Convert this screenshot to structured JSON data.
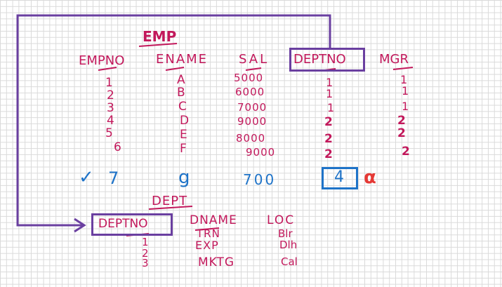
{
  "emp_table": {
    "title": "EMP",
    "headers": [
      "EMPNO",
      "ENAME",
      "SAL",
      "DEPTNO",
      "MGR"
    ],
    "rows": [
      [
        "1",
        "A",
        "5000",
        "1",
        "1"
      ],
      [
        "2",
        "B",
        "6000",
        "1",
        "1"
      ],
      [
        "3",
        "C",
        "7000",
        "1",
        "1"
      ],
      [
        "4",
        "D",
        "9000",
        "2",
        "2"
      ],
      [
        "5",
        "E",
        "8000",
        "2",
        "2"
      ],
      [
        "6",
        "F",
        "9000",
        "2",
        "2"
      ]
    ],
    "new_row": {
      "check": "✓",
      "empno": "7",
      "ename": "g",
      "sal": "700",
      "deptno": "4",
      "symbol": "α"
    }
  },
  "dept_table": {
    "title": "DEPT",
    "headers": [
      "DEPTNO",
      "DNAME",
      "LOC"
    ],
    "rows": [
      [
        "1",
        "TRN",
        "Blr"
      ],
      [
        "2",
        "EXP",
        "Dlh"
      ],
      [
        "3",
        "MKTG",
        "Cal"
      ]
    ]
  },
  "colors": {
    "ink": "#c2185b",
    "new_row": "#1e73c8",
    "alpha": "#e53935",
    "box": "#6a3fa0"
  }
}
